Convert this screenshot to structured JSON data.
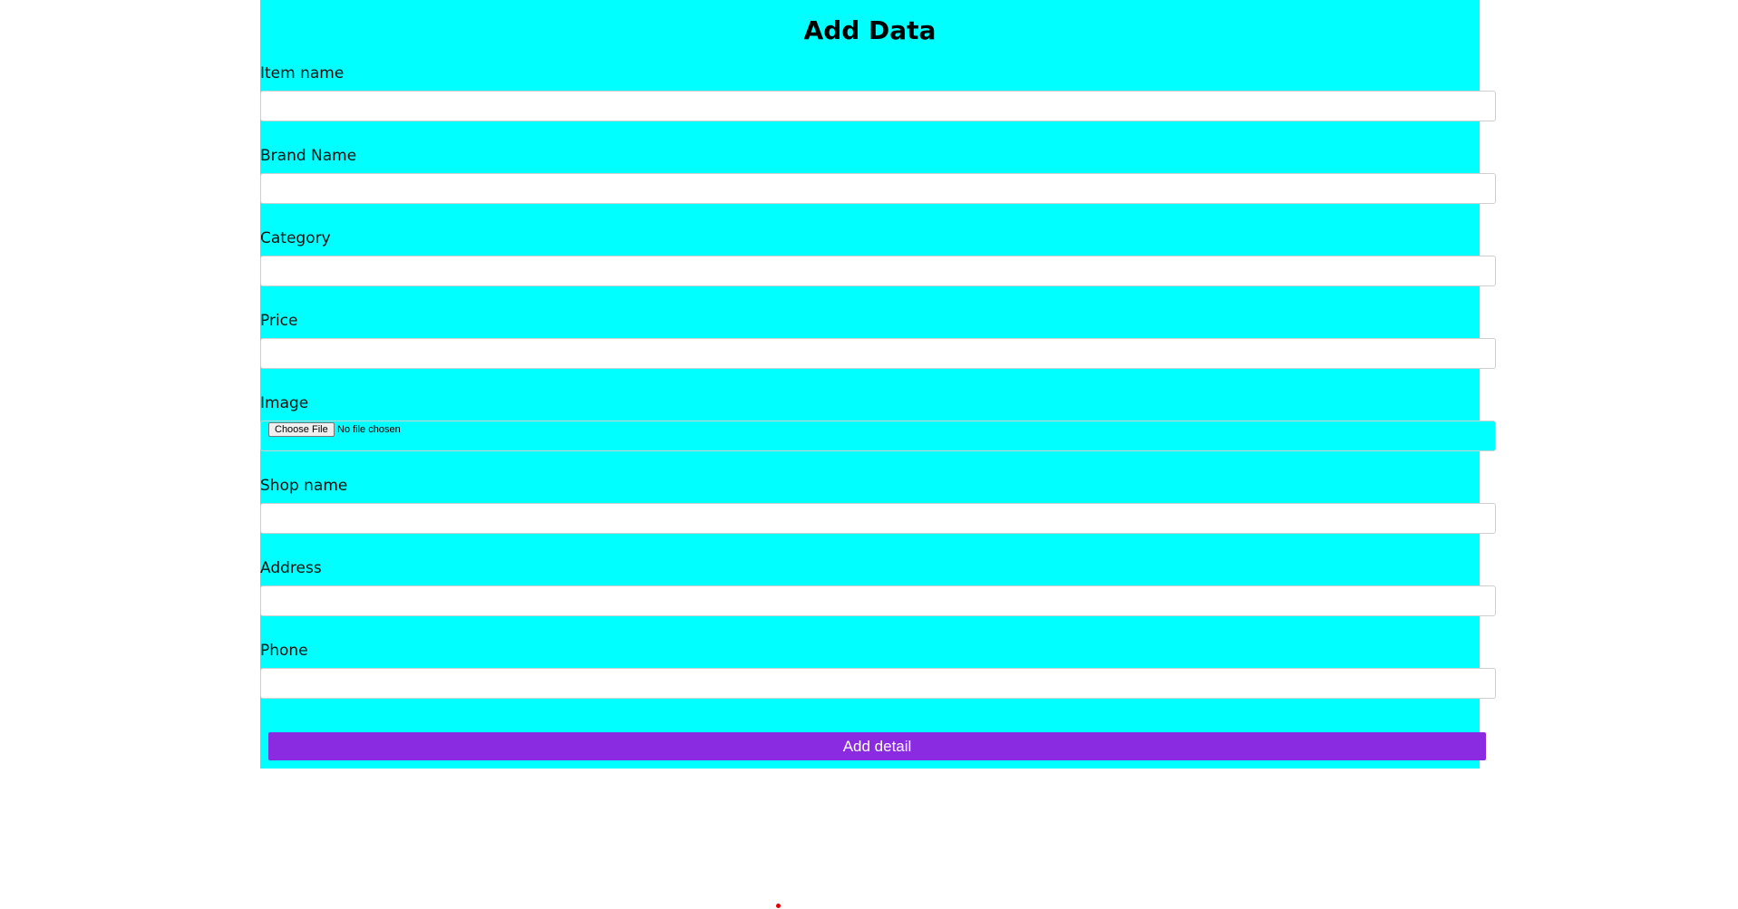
{
  "form": {
    "title": "Add Data",
    "fields": [
      {
        "label": "Item name",
        "value": ""
      },
      {
        "label": "Brand Name",
        "value": ""
      },
      {
        "label": "Category",
        "value": ""
      },
      {
        "label": "Price",
        "value": ""
      },
      {
        "label": "Image",
        "button_label": "Choose File",
        "status": "No file chosen"
      },
      {
        "label": "Shop name",
        "value": ""
      },
      {
        "label": "Address",
        "value": ""
      },
      {
        "label": "Phone",
        "value": ""
      }
    ],
    "submit_label": "Add detail"
  },
  "colors": {
    "panel_background": "#00ffff",
    "submit_button": "#8a2be2",
    "dot": "#e00000"
  }
}
